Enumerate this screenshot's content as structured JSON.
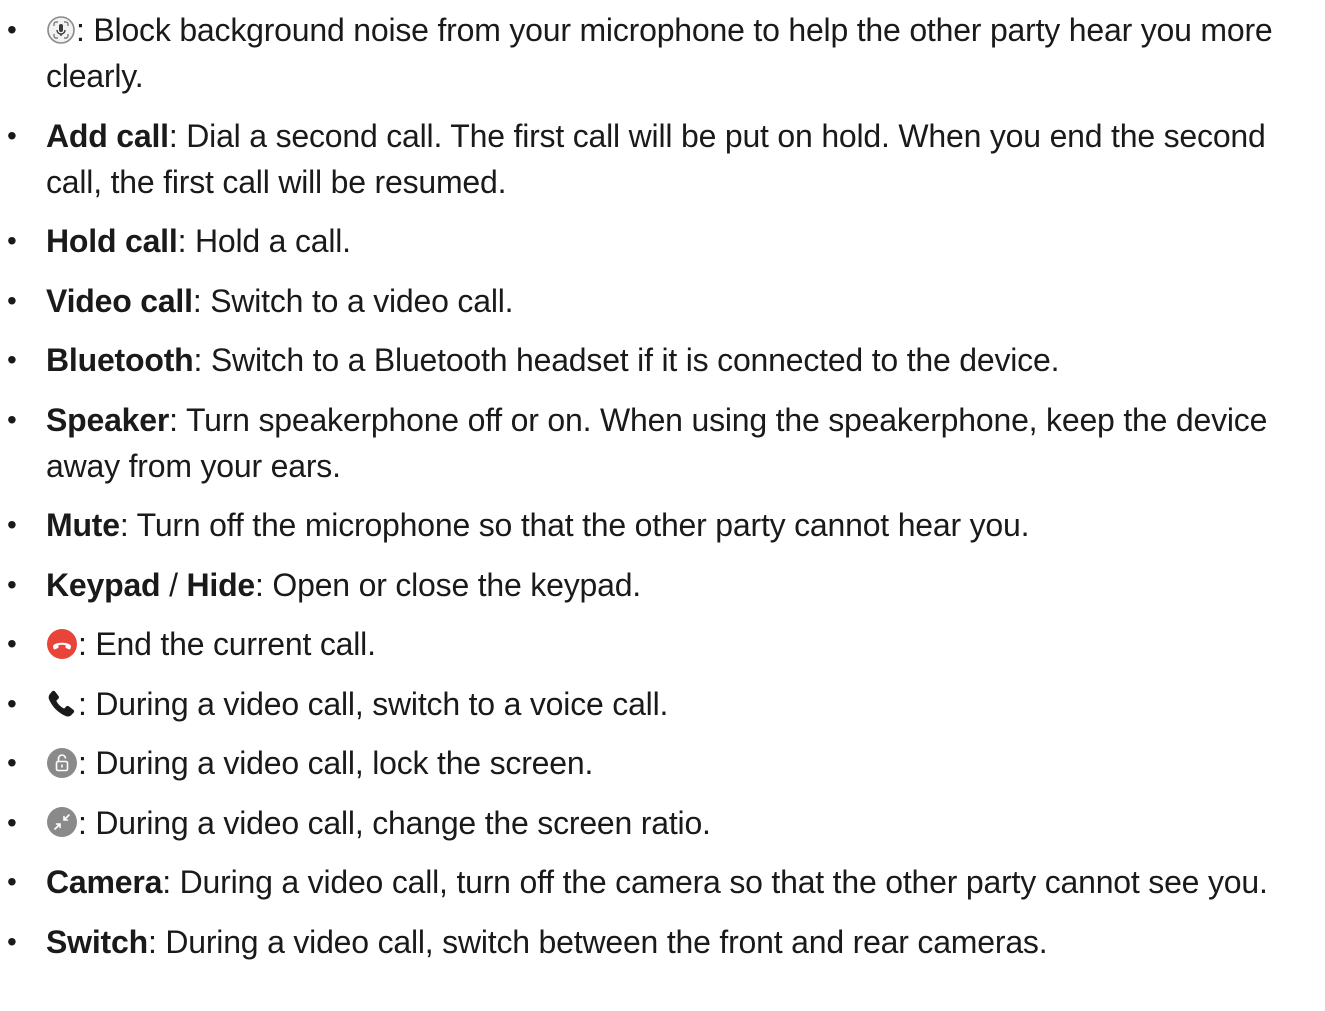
{
  "items": [
    {
      "icon": "noise-suppression-mic-icon",
      "sep": ": ",
      "desc": "Block background noise from your microphone to help the other party hear you more clearly."
    },
    {
      "term": "Add call",
      "sep": ": ",
      "desc": "Dial a second call. The first call will be put on hold. When you end the second call, the first call will be resumed."
    },
    {
      "term": "Hold call",
      "sep": ": ",
      "desc": "Hold a call."
    },
    {
      "term": "Video call",
      "sep": ": ",
      "desc": "Switch to a video call."
    },
    {
      "term": "Bluetooth",
      "sep": ": ",
      "desc": "Switch to a Bluetooth headset if it is connected to the device."
    },
    {
      "term": "Speaker",
      "sep": ": ",
      "desc": "Turn speakerphone off or on. When using the speakerphone, keep the device away from your ears."
    },
    {
      "term": "Mute",
      "sep": ": ",
      "desc": "Turn off the microphone so that the other party cannot hear you."
    },
    {
      "term": "Keypad",
      "slash": " / ",
      "term2": "Hide",
      "sep": ": ",
      "desc": "Open or close the keypad."
    },
    {
      "icon": "end-call-icon",
      "sep": ": ",
      "desc": "End the current call."
    },
    {
      "icon": "phone-icon",
      "sep": ": ",
      "desc": "During a video call, switch to a voice call."
    },
    {
      "icon": "lock-screen-icon",
      "sep": ": ",
      "desc": "During a video call, lock the screen."
    },
    {
      "icon": "screen-ratio-icon",
      "sep": ": ",
      "desc": "During a video call, change the screen ratio."
    },
    {
      "term": "Camera",
      "sep": ": ",
      "desc": "During a video call, turn off the camera so that the other party cannot see you."
    },
    {
      "term": "Switch",
      "sep": ": ",
      "desc": "During a video call, switch between the front and rear cameras."
    }
  ],
  "colors": {
    "text": "#1a1a1a",
    "end_call_red": "#e8443a",
    "icon_grey": "#7a7a7a"
  }
}
